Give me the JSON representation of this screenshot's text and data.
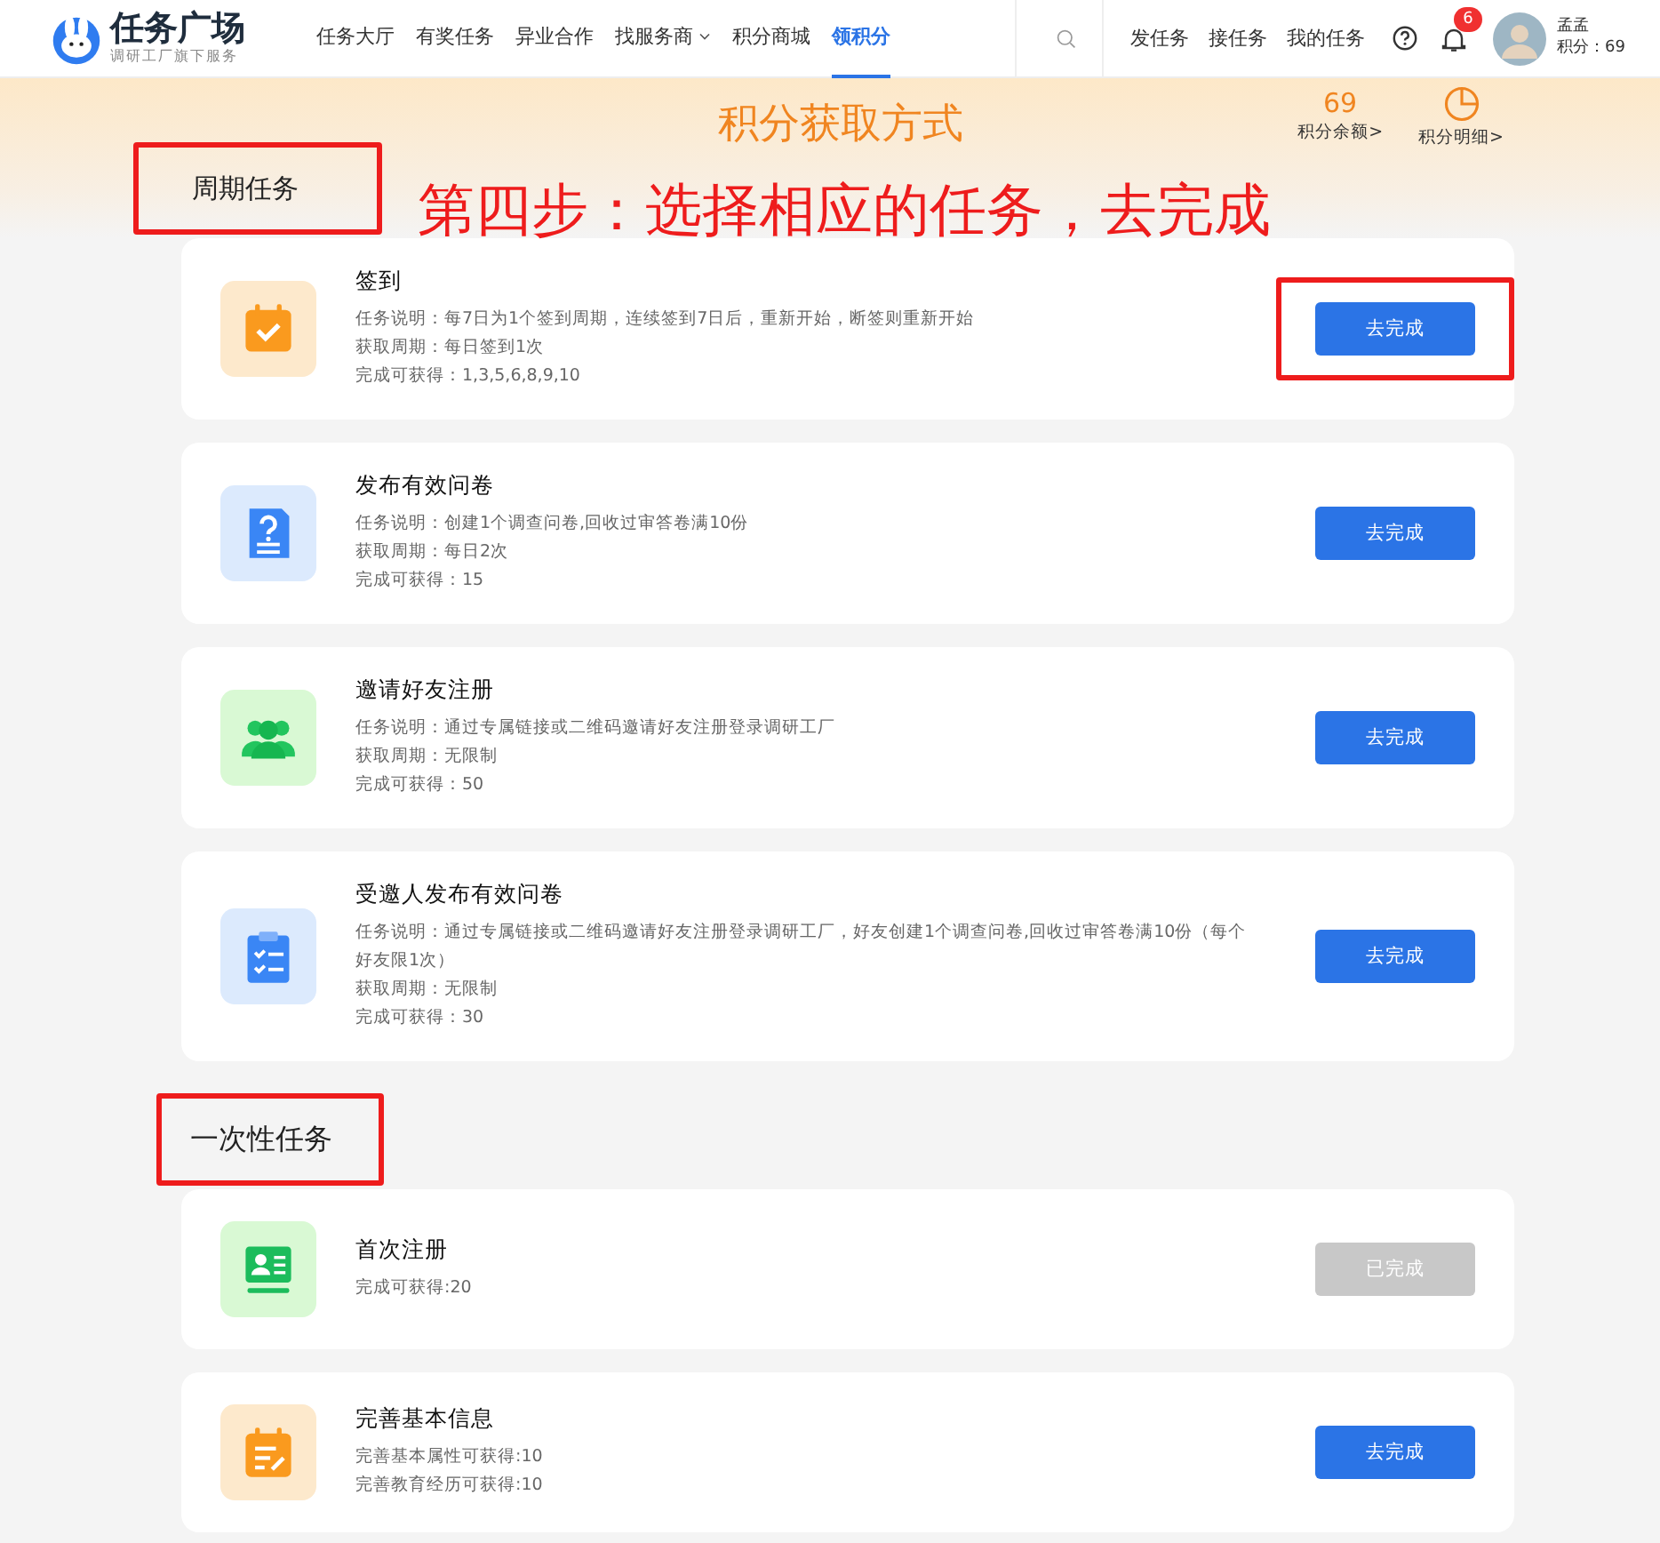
{
  "header": {
    "logo_title": "任务广场",
    "logo_subtitle": "调研工厂旗下服务",
    "nav": [
      {
        "label": "任务大厅",
        "selected": false,
        "dropdown": false
      },
      {
        "label": "有奖任务",
        "selected": false,
        "dropdown": false
      },
      {
        "label": "异业合作",
        "selected": false,
        "dropdown": false
      },
      {
        "label": "找服务商",
        "selected": false,
        "dropdown": true
      },
      {
        "label": "积分商城",
        "selected": false,
        "dropdown": false
      },
      {
        "label": "领积分",
        "selected": true,
        "dropdown": false
      }
    ],
    "actions": [
      "发任务",
      "接任务",
      "我的任务"
    ],
    "notification_count": "6",
    "user_name": "孟孟",
    "user_points": "积分：69"
  },
  "banner": {
    "title": "积分获取方式",
    "balance": "69",
    "balance_label": "积分余额>",
    "detail_label": "积分明细>"
  },
  "annotation": "第四步：选择相应的任务，去完成",
  "sections": [
    {
      "title": "周期任务",
      "highlighted": true,
      "tasks": [
        {
          "kind": "calendar",
          "title": "签到",
          "lines": [
            "任务说明：每7日为1个签到周期，连续签到7日后，重新开始，断签则重新开始",
            "获取周期：每日签到1次",
            "完成可获得：1,3,5,6,8,9,10"
          ],
          "button": "去完成",
          "completed": false,
          "highlighted": true
        },
        {
          "kind": "survey",
          "title": "发布有效问卷",
          "lines": [
            "任务说明：创建1个调查问卷,回收过审答卷满10份",
            "获取周期：每日2次",
            "完成可获得：15"
          ],
          "button": "去完成",
          "completed": false,
          "highlighted": false
        },
        {
          "kind": "people",
          "title": "邀请好友注册",
          "lines": [
            "任务说明：通过专属链接或二维码邀请好友注册登录调研工厂",
            "获取周期：无限制",
            "完成可获得：50"
          ],
          "button": "去完成",
          "completed": false,
          "highlighted": false
        },
        {
          "kind": "clipboard",
          "title": "受邀人发布有效问卷",
          "lines": [
            "任务说明：通过专属链接或二维码邀请好友注册登录调研工厂，好友创建1个调查问卷,回收过审答卷满10份（每个好友限1次）",
            "获取周期：无限制",
            "完成可获得：30"
          ],
          "button": "去完成",
          "completed": false,
          "highlighted": false
        }
      ]
    },
    {
      "title": "一次性任务",
      "highlighted": true,
      "tasks": [
        {
          "kind": "register",
          "title": "首次注册",
          "lines": [
            "完成可获得:20"
          ],
          "button": "已完成",
          "completed": true,
          "highlighted": false
        },
        {
          "kind": "edit",
          "title": "完善基本信息",
          "lines": [
            "完善基本属性可获得:10",
            "完善教育经历可获得:10"
          ],
          "button": "去完成",
          "completed": false,
          "highlighted": false
        }
      ]
    }
  ]
}
